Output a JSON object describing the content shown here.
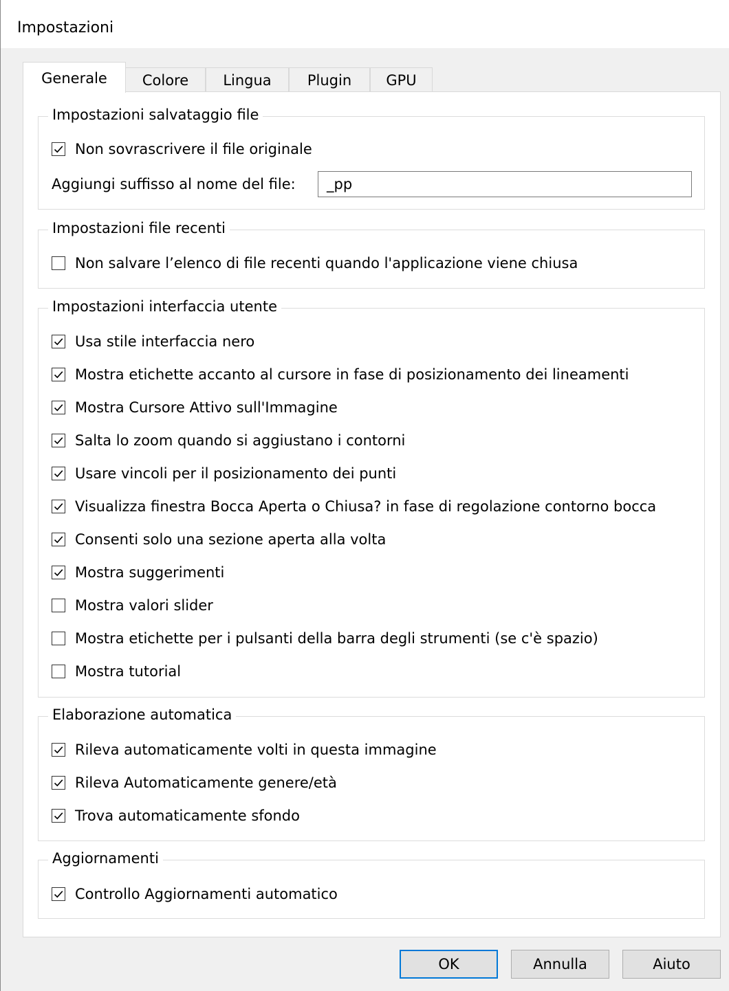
{
  "window": {
    "title": "Impostazioni"
  },
  "tabs": [
    "Generale",
    "Colore",
    "Lingua",
    "Plugin",
    "GPU"
  ],
  "groups": {
    "file_save": {
      "title": "Impostazioni salvataggio file",
      "no_overwrite": {
        "label": "Non sovrascrivere il file originale",
        "checked": true
      },
      "suffix_label": "Aggiungi suffisso al nome del file:",
      "suffix_value": "_pp"
    },
    "recent_files": {
      "title": "Impostazioni file recenti",
      "items": [
        {
          "label": "Non salvare l’elenco di file recenti quando l'applicazione viene chiusa",
          "checked": false
        }
      ]
    },
    "ui": {
      "title": "Impostazioni interfaccia utente",
      "items": [
        {
          "label": "Usa stile interfaccia nero",
          "checked": true
        },
        {
          "label": "Mostra etichette accanto al cursore in fase di posizionamento dei lineamenti",
          "checked": true
        },
        {
          "label": "Mostra Cursore Attivo sull'Immagine",
          "checked": true
        },
        {
          "label": "Salta lo zoom quando si aggiustano i contorni",
          "checked": true
        },
        {
          "label": "Usare vincoli per il posizionamento dei punti",
          "checked": true
        },
        {
          "label": "Visualizza finestra Bocca Aperta o Chiusa? in fase di regolazione contorno bocca",
          "checked": true
        },
        {
          "label": "Consenti solo una sezione aperta alla volta",
          "checked": true
        },
        {
          "label": "Mostra suggerimenti",
          "checked": true
        },
        {
          "label": "Mostra valori slider",
          "checked": false
        },
        {
          "label": "Mostra etichette per i pulsanti della barra degli strumenti (se c'è spazio)",
          "checked": false
        },
        {
          "label": "Mostra tutorial",
          "checked": false
        }
      ]
    },
    "auto": {
      "title": "Elaborazione automatica",
      "items": [
        {
          "label": "Rileva automaticamente volti in questa immagine",
          "checked": true
        },
        {
          "label": "Rileva Automaticamente genere/età",
          "checked": true
        },
        {
          "label": "Trova automaticamente sfondo",
          "checked": true
        }
      ]
    },
    "updates": {
      "title": "Aggiornamenti",
      "items": [
        {
          "label": "Controllo Aggiornamenti automatico",
          "checked": true
        }
      ]
    }
  },
  "buttons": {
    "ok": "OK",
    "cancel": "Annulla",
    "help": "Aiuto"
  }
}
